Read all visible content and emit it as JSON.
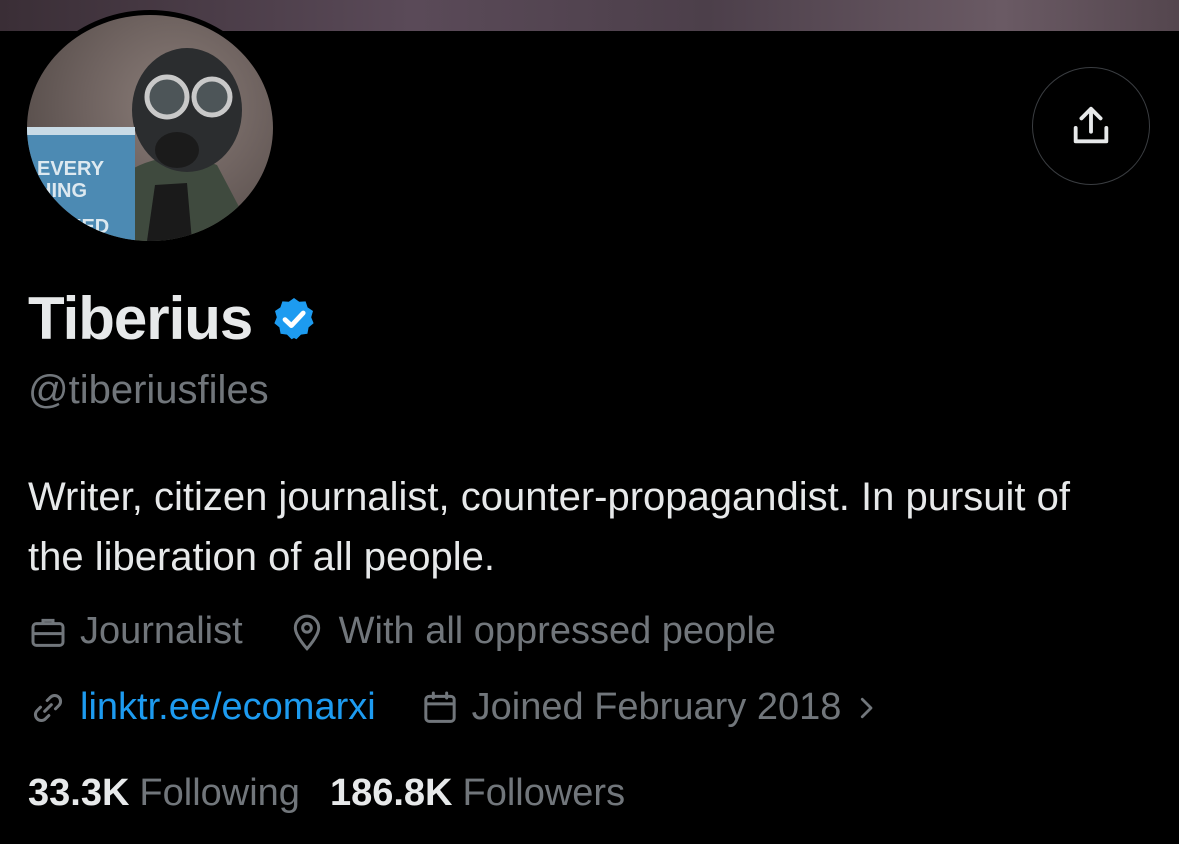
{
  "profile": {
    "display_name": "Tiberius",
    "handle": "@tiberiusfiles",
    "bio": "Writer, citizen journalist, counter-propagandist. In pursuit of the liberation of all people.",
    "avatar_book_text": [
      "EVERY",
      "HING",
      "KED"
    ]
  },
  "meta": {
    "profession": "Journalist",
    "location": "With all oppressed people",
    "website": "linktr.ee/ecomarxi",
    "joined": "Joined February 2018"
  },
  "stats": {
    "following_count": "33.3K",
    "following_label": "Following",
    "followers_count": "186.8K",
    "followers_label": "Followers"
  },
  "icons": {
    "share": "share-icon",
    "verified": "verified-badge-icon",
    "profession": "briefcase-icon",
    "location": "location-pin-icon",
    "website": "link-icon",
    "joined": "calendar-icon",
    "joined_chevron": "chevron-right-icon"
  },
  "colors": {
    "background": "#000000",
    "text": "#e7e9ea",
    "muted": "#71767b",
    "accent": "#1d9bf0"
  }
}
